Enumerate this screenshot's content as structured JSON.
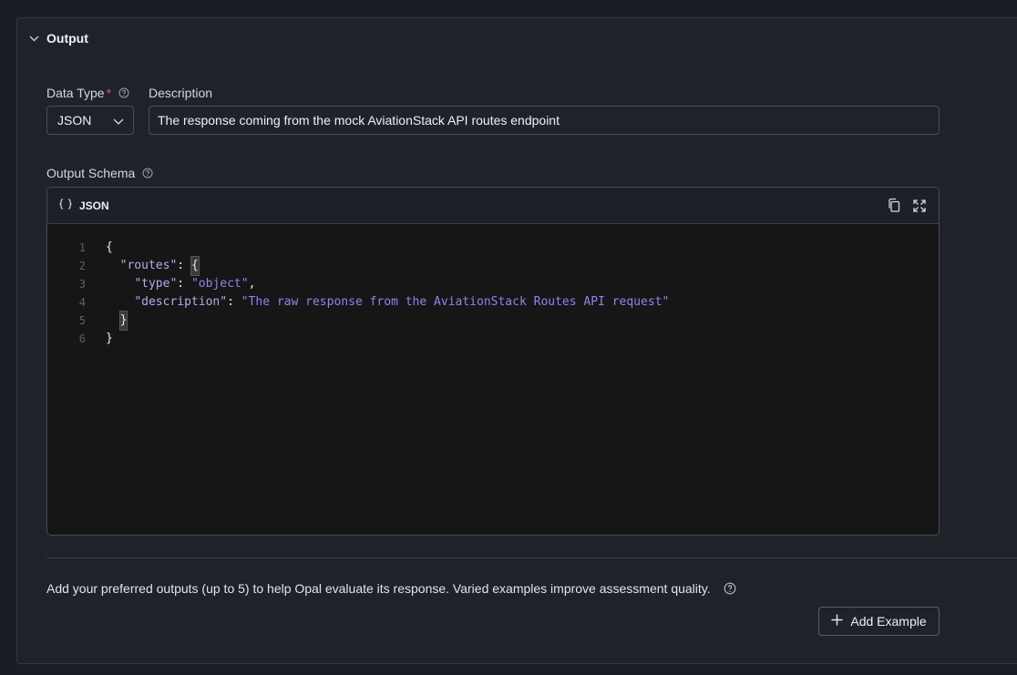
{
  "section": {
    "title": "Output",
    "expanded": true
  },
  "data_type": {
    "label": "Data Type",
    "required_mark": "*",
    "selected": "JSON"
  },
  "description": {
    "label": "Description",
    "value": "The response coming from the mock AviationStack API routes endpoint"
  },
  "output_schema": {
    "label": "Output Schema",
    "editor": {
      "language_label": "JSON",
      "lines": [
        {
          "num": "1",
          "text": "{"
        },
        {
          "num": "2",
          "key": "\"routes\"",
          "rest": ": ",
          "brace": "{"
        },
        {
          "num": "3",
          "key": "\"type\"",
          "rest": ": ",
          "value": "\"object\"",
          "tail": ","
        },
        {
          "num": "4",
          "key": "\"description\"",
          "rest": ": ",
          "value": "\"The raw response from the AviationStack Routes API request\"",
          "tail": ""
        },
        {
          "num": "5",
          "text": "}"
        },
        {
          "num": "6",
          "text": "}"
        }
      ]
    }
  },
  "examples": {
    "hint": "Add your preferred outputs (up to 5) to help Opal evaluate its response. Varied examples improve assessment quality.",
    "add_button_label": "Add Example"
  },
  "colors": {
    "background": "#1b1d24",
    "panel": "#20222a",
    "editor_bg": "#161616",
    "required": "#e4525c",
    "json_key": "#b8a7f0",
    "json_string": "#9b7ef0"
  }
}
